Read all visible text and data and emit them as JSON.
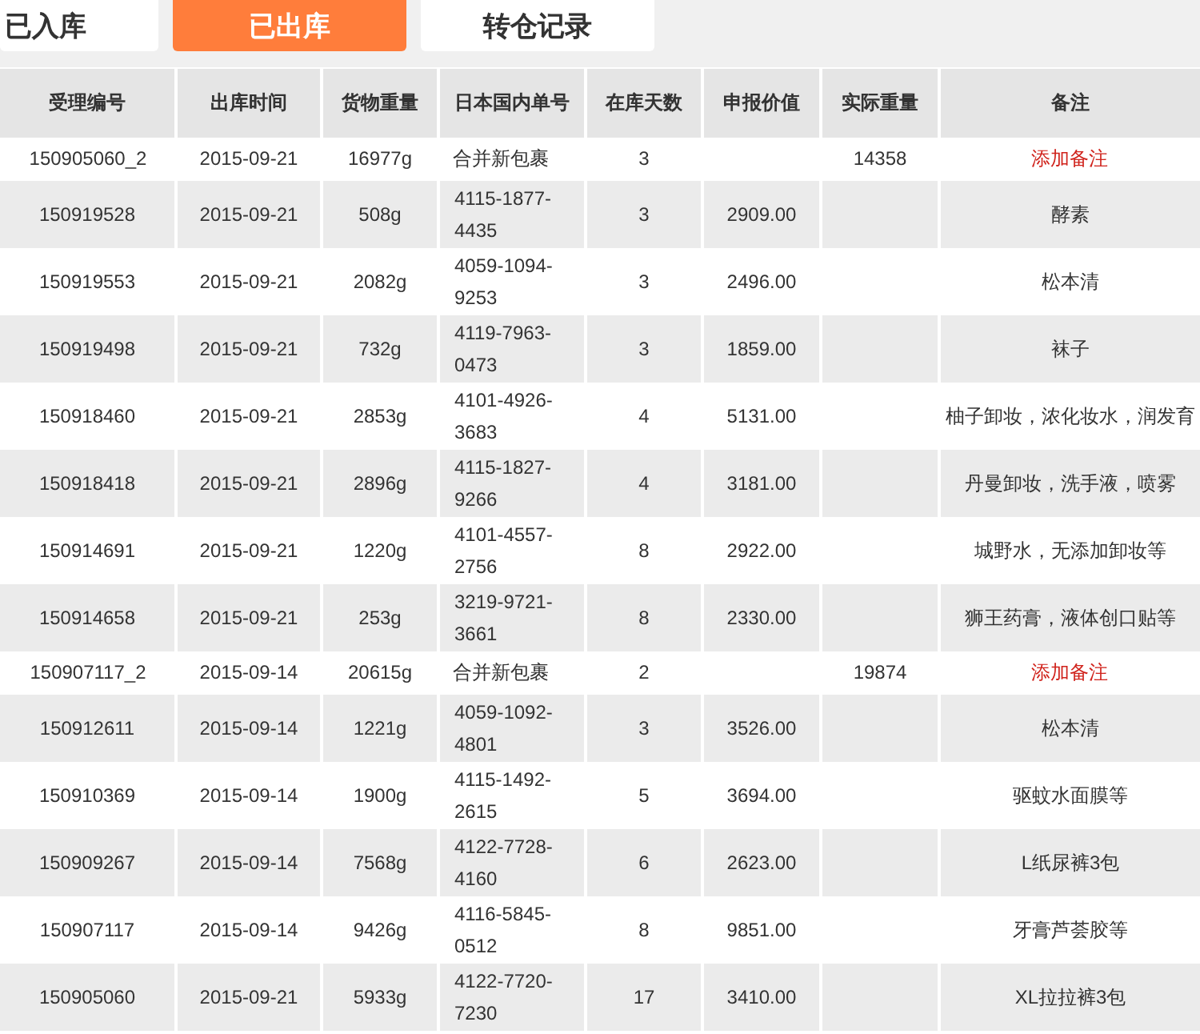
{
  "tabs": [
    {
      "label": "已入库",
      "selected": false
    },
    {
      "label": "已出库",
      "selected": true
    },
    {
      "label": "转仓记录",
      "selected": false
    }
  ],
  "table": {
    "columns": [
      "受理编号",
      "出库时间",
      "货物重量",
      "日本国内单号",
      "在库天数",
      "申报价值",
      "实际重量",
      "备注"
    ],
    "rows": [
      {
        "kind": "merged",
        "id": "150905060_2",
        "date": "2015-09-21",
        "weight": "16977g",
        "domestic_no": "合并新包裹",
        "days": "3",
        "actual_weight": "14358",
        "remark": "添加备注"
      },
      {
        "kind": "item",
        "id": "150919528",
        "date": "2015-09-21",
        "weight": "508g",
        "domestic_no": "4115-1877-4435",
        "days": "3",
        "declared_value": "2909.00",
        "remark": "酵素"
      },
      {
        "kind": "item",
        "id": "150919553",
        "date": "2015-09-21",
        "weight": "2082g",
        "domestic_no": "4059-1094-9253",
        "days": "3",
        "declared_value": "2496.00",
        "remark": "松本清"
      },
      {
        "kind": "item",
        "id": "150919498",
        "date": "2015-09-21",
        "weight": "732g",
        "domestic_no": "4119-7963-0473",
        "days": "3",
        "declared_value": "1859.00",
        "remark": "袜子"
      },
      {
        "kind": "item",
        "id": "150918460",
        "date": "2015-09-21",
        "weight": "2853g",
        "domestic_no": "4101-4926-3683",
        "days": "4",
        "declared_value": "5131.00",
        "remark": "柚子卸妆，浓化妆水，润发育"
      },
      {
        "kind": "item",
        "id": "150918418",
        "date": "2015-09-21",
        "weight": "2896g",
        "domestic_no": "4115-1827-9266",
        "days": "4",
        "declared_value": "3181.00",
        "remark": "丹曼卸妆，洗手液，喷雾"
      },
      {
        "kind": "item",
        "id": "150914691",
        "date": "2015-09-21",
        "weight": "1220g",
        "domestic_no": "4101-4557-2756",
        "days": "8",
        "declared_value": "2922.00",
        "remark": "城野水，无添加卸妆等"
      },
      {
        "kind": "item",
        "id": "150914658",
        "date": "2015-09-21",
        "weight": "253g",
        "domestic_no": "3219-9721-3661",
        "days": "8",
        "declared_value": "2330.00",
        "remark": "狮王药膏，液体创口贴等"
      },
      {
        "kind": "merged",
        "id": "150907117_2",
        "date": "2015-09-14",
        "weight": "20615g",
        "domestic_no": "合并新包裹",
        "days": "2",
        "actual_weight": "19874",
        "remark": "添加备注"
      },
      {
        "kind": "item",
        "id": "150912611",
        "date": "2015-09-14",
        "weight": "1221g",
        "domestic_no": "4059-1092-4801",
        "days": "3",
        "declared_value": "3526.00",
        "remark": "松本清"
      },
      {
        "kind": "item",
        "id": "150910369",
        "date": "2015-09-14",
        "weight": "1900g",
        "domestic_no": "4115-1492-2615",
        "days": "5",
        "declared_value": "3694.00",
        "remark": "驱蚊水面膜等"
      },
      {
        "kind": "item",
        "id": "150909267",
        "date": "2015-09-14",
        "weight": "7568g",
        "domestic_no": "4122-7728-4160",
        "days": "6",
        "declared_value": "2623.00",
        "remark": "L纸尿裤3包"
      },
      {
        "kind": "item",
        "id": "150907117",
        "date": "2015-09-14",
        "weight": "9426g",
        "domestic_no": "4116-5845-0512",
        "days": "8",
        "declared_value": "9851.00",
        "remark": "牙膏芦荟胶等"
      },
      {
        "kind": "item",
        "id": "150905060",
        "date": "2015-09-21",
        "weight": "5933g",
        "domestic_no": "4122-7720-7230",
        "days": "17",
        "declared_value": "3410.00",
        "remark": "XL拉拉裤3包"
      }
    ]
  }
}
